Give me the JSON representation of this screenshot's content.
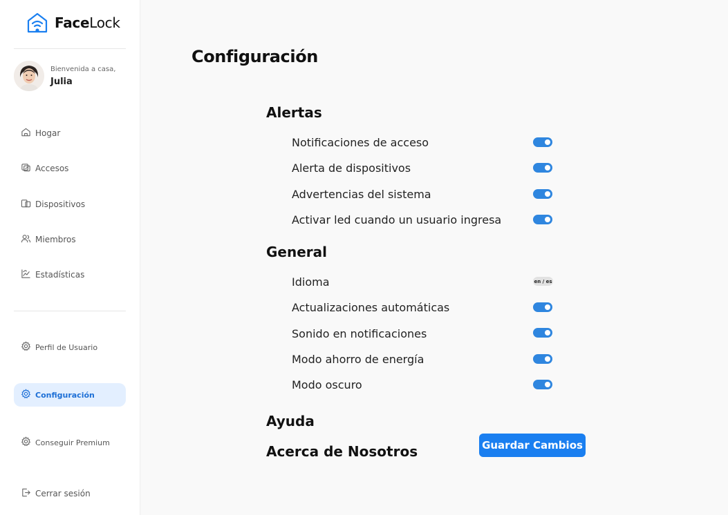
{
  "brand": {
    "name_bold": "Face",
    "name_regular": "Lock",
    "accent_color": "#1a7ff0"
  },
  "user": {
    "greeting": "Bienvenida a casa,",
    "name": "Julia"
  },
  "nav": {
    "main": [
      {
        "label": "Hogar",
        "icon": "home-icon"
      },
      {
        "label": "Accesos",
        "icon": "access-icon"
      },
      {
        "label": "Dispositivos",
        "icon": "devices-icon"
      },
      {
        "label": "Miembros",
        "icon": "members-icon"
      },
      {
        "label": "Estadísticas",
        "icon": "stats-icon"
      }
    ],
    "secondary": [
      {
        "label": "Perfil de Usuario",
        "icon": "gear-icon"
      },
      {
        "label": "Configuración",
        "icon": "gear-icon",
        "active": true
      },
      {
        "label": "Conseguir Premium",
        "icon": "gear-icon"
      },
      {
        "label": "Cerrar sesión",
        "icon": "logout-icon"
      }
    ]
  },
  "page": {
    "title": "Configuración"
  },
  "sections": {
    "alerts": {
      "title": "Alertas",
      "items": [
        {
          "label": "Notificaciones de acceso",
          "enabled": true
        },
        {
          "label": "Alerta de dispositivos",
          "enabled": true
        },
        {
          "label": "Advertencias del sistema",
          "enabled": true
        },
        {
          "label": "Activar led cuando un usuario ingresa",
          "enabled": true
        }
      ]
    },
    "general": {
      "title": "General",
      "language": {
        "label": "Idioma",
        "value": "en / es"
      },
      "items": [
        {
          "label": "Actualizaciones automáticas",
          "enabled": true
        },
        {
          "label": "Sonido en notificaciones",
          "enabled": true
        },
        {
          "label": "Modo ahorro de energía",
          "enabled": true
        },
        {
          "label": "Modo oscuro",
          "enabled": true
        }
      ]
    },
    "help": {
      "title": "Ayuda"
    },
    "about": {
      "title": "Acerca de Nosotros"
    }
  },
  "actions": {
    "save_label": "Guardar Cambios"
  },
  "colors": {
    "toggle_on": "#2f86df",
    "active_nav_bg": "#e3efff",
    "active_nav_text": "#1d6fd6"
  }
}
